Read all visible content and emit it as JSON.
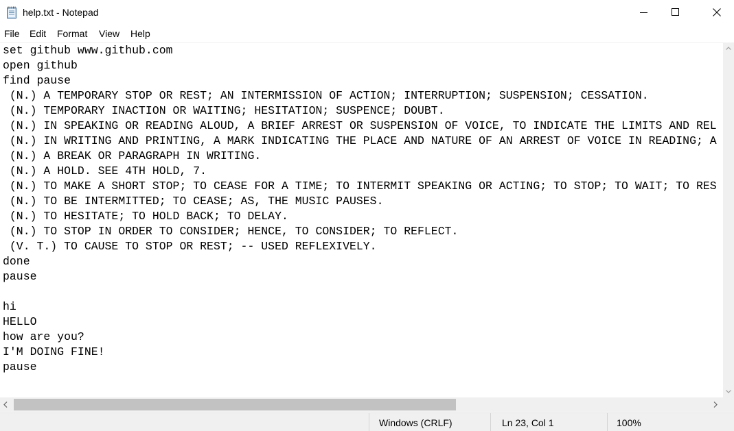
{
  "window": {
    "title": "help.txt - Notepad",
    "icon": "notepad-icon",
    "controls": {
      "minimize": "minimize-icon",
      "maximize": "maximize-icon",
      "close": "close-icon"
    }
  },
  "menu": {
    "items": [
      "File",
      "Edit",
      "Format",
      "View",
      "Help"
    ]
  },
  "editor": {
    "lines": [
      "set github www.github.com",
      "open github",
      "find pause",
      " (N.) A TEMPORARY STOP OR REST; AN INTERMISSION OF ACTION; INTERRUPTION; SUSPENSION; CESSATION.",
      " (N.) TEMPORARY INACTION OR WAITING; HESITATION; SUSPENCE; DOUBT.",
      " (N.) IN SPEAKING OR READING ALOUD, A BRIEF ARREST OR SUSPENSION OF VOICE, TO INDICATE THE LIMITS AND REL",
      " (N.) IN WRITING AND PRINTING, A MARK INDICATING THE PLACE AND NATURE OF AN ARREST OF VOICE IN READING; A",
      " (N.) A BREAK OR PARAGRAPH IN WRITING.",
      " (N.) A HOLD. SEE 4TH HOLD, 7.",
      " (N.) TO MAKE A SHORT STOP; TO CEASE FOR A TIME; TO INTERMIT SPEAKING OR ACTING; TO STOP; TO WAIT; TO RES",
      " (N.) TO BE INTERMITTED; TO CEASE; AS, THE MUSIC PAUSES.",
      " (N.) TO HESITATE; TO HOLD BACK; TO DELAY.",
      " (N.) TO STOP IN ORDER TO CONSIDER; HENCE, TO CONSIDER; TO REFLECT.",
      " (V. T.) TO CAUSE TO STOP OR REST; -- USED REFLEXIVELY.",
      "done",
      "pause",
      "",
      "hi",
      "HELLO",
      "how are you?",
      "I'M DOING FINE!",
      "pause"
    ]
  },
  "scrollbars": {
    "vertical": {
      "up": "chevron-up-icon",
      "down": "chevron-down-icon"
    },
    "horizontal": {
      "left": "chevron-left-icon",
      "right": "chevron-right-icon"
    }
  },
  "status": {
    "line_ending": "Windows (CRLF)",
    "position": "Ln 23, Col 1",
    "zoom": "100%"
  }
}
